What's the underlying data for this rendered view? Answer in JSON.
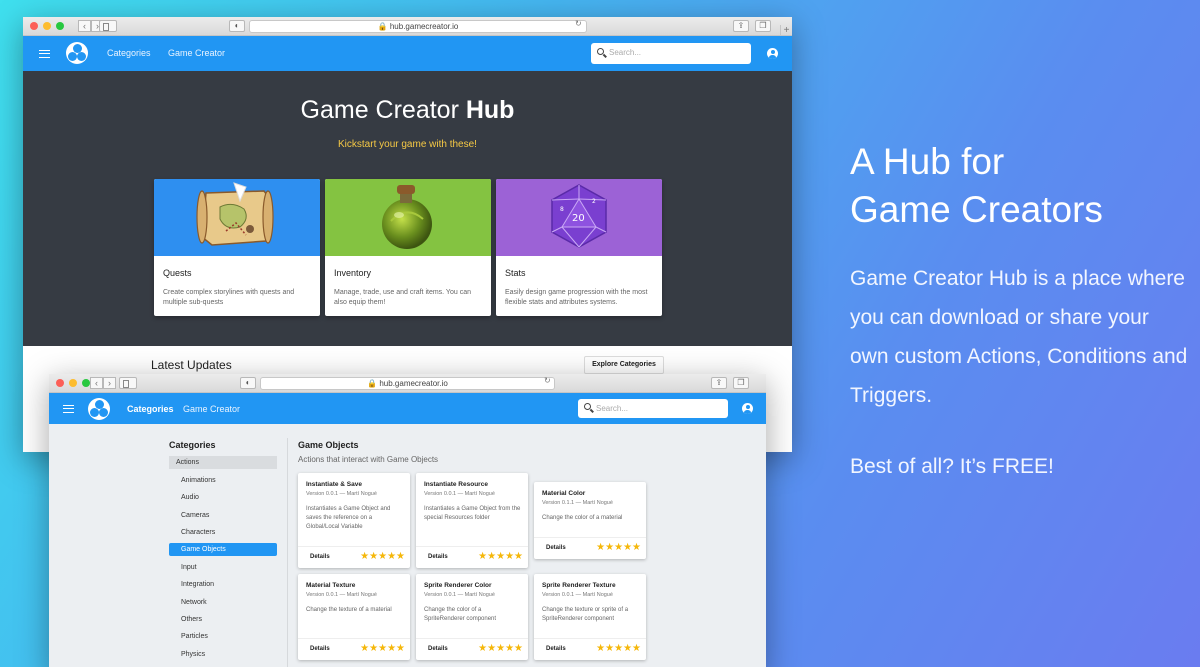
{
  "window_back": {
    "url": "hub.gamecreator.io",
    "nav": {
      "categories": "Categories",
      "game_creator": "Game Creator"
    },
    "search_placeholder": "Search...",
    "hero": {
      "title_regular": "Game Creator",
      "title_bold": "Hub",
      "subtitle": "Kickstart your game with these!"
    },
    "cards": [
      {
        "title": "Quests",
        "desc": "Create complex storylines with quests and multiple sub-quests",
        "color": "#2e8ff0",
        "icon": "treasure-map-icon"
      },
      {
        "title": "Inventory",
        "desc": "Manage, trade, use and craft items. You can also equip them!",
        "color": "#84c341",
        "icon": "potion-icon"
      },
      {
        "title": "Stats",
        "desc": "Easily design game progression with the most flexible stats and attributes systems.",
        "color": "#9c62d6",
        "icon": "d20-dice-icon"
      }
    ],
    "latest_updates": "Latest Updates",
    "explore_button": "Explore Categories"
  },
  "window_front": {
    "url": "hub.gamecreator.io",
    "nav": {
      "categories": "Categories",
      "game_creator": "Game Creator"
    },
    "search_placeholder": "Search...",
    "sidebar": {
      "title": "Categories",
      "items": [
        "Actions",
        "Animations",
        "Audio",
        "Cameras",
        "Characters",
        "Game Objects",
        "Input",
        "Integration",
        "Network",
        "Others",
        "Particles",
        "Physics"
      ],
      "selected": "Game Objects"
    },
    "section": {
      "title": "Game Objects",
      "subtitle": "Actions that interact with Game Objects"
    },
    "actions": [
      {
        "title": "Instantiate & Save",
        "version": "Version 0.0.1 — Martí Nogué",
        "desc": "Instantiates a Game Object and saves the reference on a Global/Local Variable",
        "details": "Details",
        "stars": "★★★★★"
      },
      {
        "title": "Instantiate Resource",
        "version": "Version 0.0.1 — Martí Nogué",
        "desc": "Instantiates a Game Object from the special Resources folder",
        "details": "Details",
        "stars": "★★★★★"
      },
      {
        "title": "Material Color",
        "version": "Version 0.1.1 — Martí Nogué",
        "desc": "Change the color of a material",
        "details": "Details",
        "stars": "★★★★★"
      },
      {
        "title": "Material Texture",
        "version": "Version 0.0.1 — Martí Nogué",
        "desc": "Change the texture of a material",
        "details": "Details",
        "stars": "★★★★★"
      },
      {
        "title": "Sprite Renderer Color",
        "version": "Version 0.0.1 — Martí Nogué",
        "desc": "Change the color of a SpriteRenderer component",
        "details": "Details",
        "stars": "★★★★★"
      },
      {
        "title": "Sprite Renderer Texture",
        "version": "Version 0.0.1 — Martí Nogué",
        "desc": "Change the texture or sprite of a SpriteRenderer component",
        "details": "Details",
        "stars": "★★★★★"
      }
    ]
  },
  "promo": {
    "headline_line1": "A Hub for",
    "headline_line2": "Game Creators",
    "description": "Game Creator Hub is a place where you can download or share your own custom Actions, Conditions and Triggers.",
    "tagline": "Best of all? It’s FREE!"
  },
  "colors": {
    "toolbar_blue": "#2196f3",
    "hero_dark": "#363b43",
    "subtitle_yellow": "#f6c945",
    "star_gold": "#f5b70a"
  }
}
